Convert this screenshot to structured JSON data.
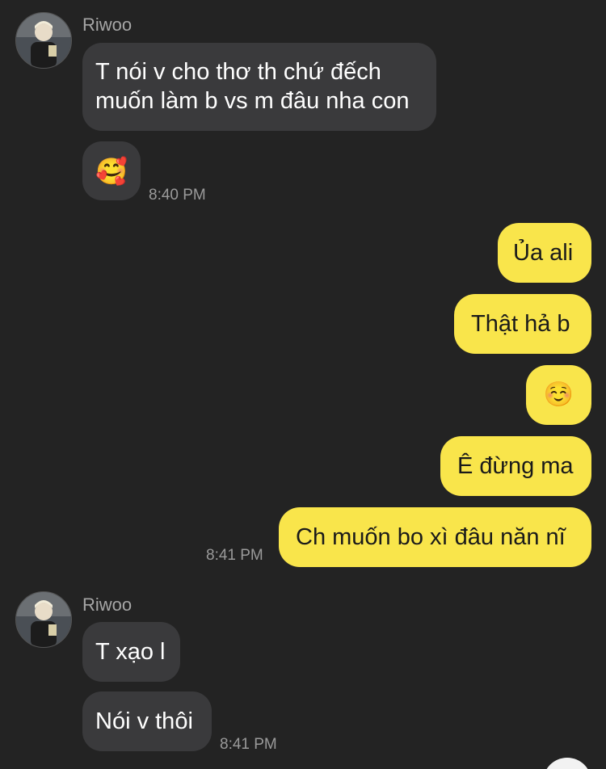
{
  "conversation": {
    "contact_name": "Riwoo",
    "group1": {
      "sender": "Riwoo",
      "messages": [
        {
          "line1": "T nói v cho thơ th chứ đếch",
          "line2": "muốn làm b vs m đâu nha con"
        },
        {
          "emoji": "🥰"
        }
      ],
      "time": "8:40 PM"
    },
    "group2_outgoing": {
      "messages": [
        "Ủa ali",
        "Thật hả b",
        "☺️",
        "Ê đừng ma",
        "Ch muốn bo xì đâu năn nĩ"
      ],
      "time": "8:41 PM"
    },
    "group3": {
      "sender": "Riwoo",
      "messages": [
        "T xạo l",
        "Nói v thôi"
      ],
      "time": "8:41 PM"
    }
  },
  "colors": {
    "background": "#232323",
    "incoming_bubble": "#3a3a3c",
    "outgoing_bubble": "#f9e54b"
  },
  "icons": {
    "avatar": "profile-photo-icon"
  }
}
